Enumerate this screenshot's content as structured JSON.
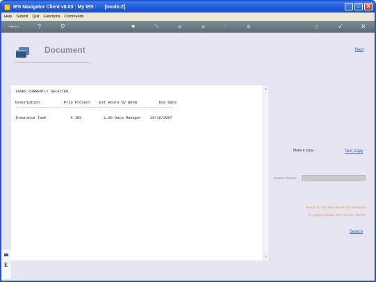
{
  "window": {
    "title": "IES Navigator Client v8.03 : My IES :      [mode-Z]",
    "minimize": "_",
    "maximize": "□",
    "close": "X"
  },
  "menu": {
    "items": [
      "Help",
      "Submit",
      "Quit",
      "Functions",
      "Commands"
    ]
  },
  "toolbar": {
    "icons": [
      "key-icon",
      "help-icon",
      "search-icon",
      "heart-icon",
      "edit-icon",
      "back-icon",
      "forward-icon",
      "up-icon",
      "stop-icon",
      "home-icon",
      "check-icon",
      "close-icon"
    ]
  },
  "header": {
    "title": "Document",
    "next_label": "Next"
  },
  "report": {
    "heading": "TASKS CURRENTLY SELECTED.",
    "columns_line": "Description           Prio Project    Est Hours by Whom          Due Date",
    "separator": "------------------------------------------------------------------------",
    "row": "Insurance Task           4 IES          1.00 Data Manager    29/10/2007"
  },
  "actions": {
    "make_copy_label": "Make a copy -",
    "text_copy_label": "Text Copy",
    "search_phrase_label": "Search Phrase",
    "search_phrase_value": "",
    "hint_line1": "Search the IES Help for the documentation",
    "hint_line2": "by typing a phrase, then choose \"search\"",
    "search_label": "Search"
  },
  "sidebar": {
    "letter": "E"
  }
}
